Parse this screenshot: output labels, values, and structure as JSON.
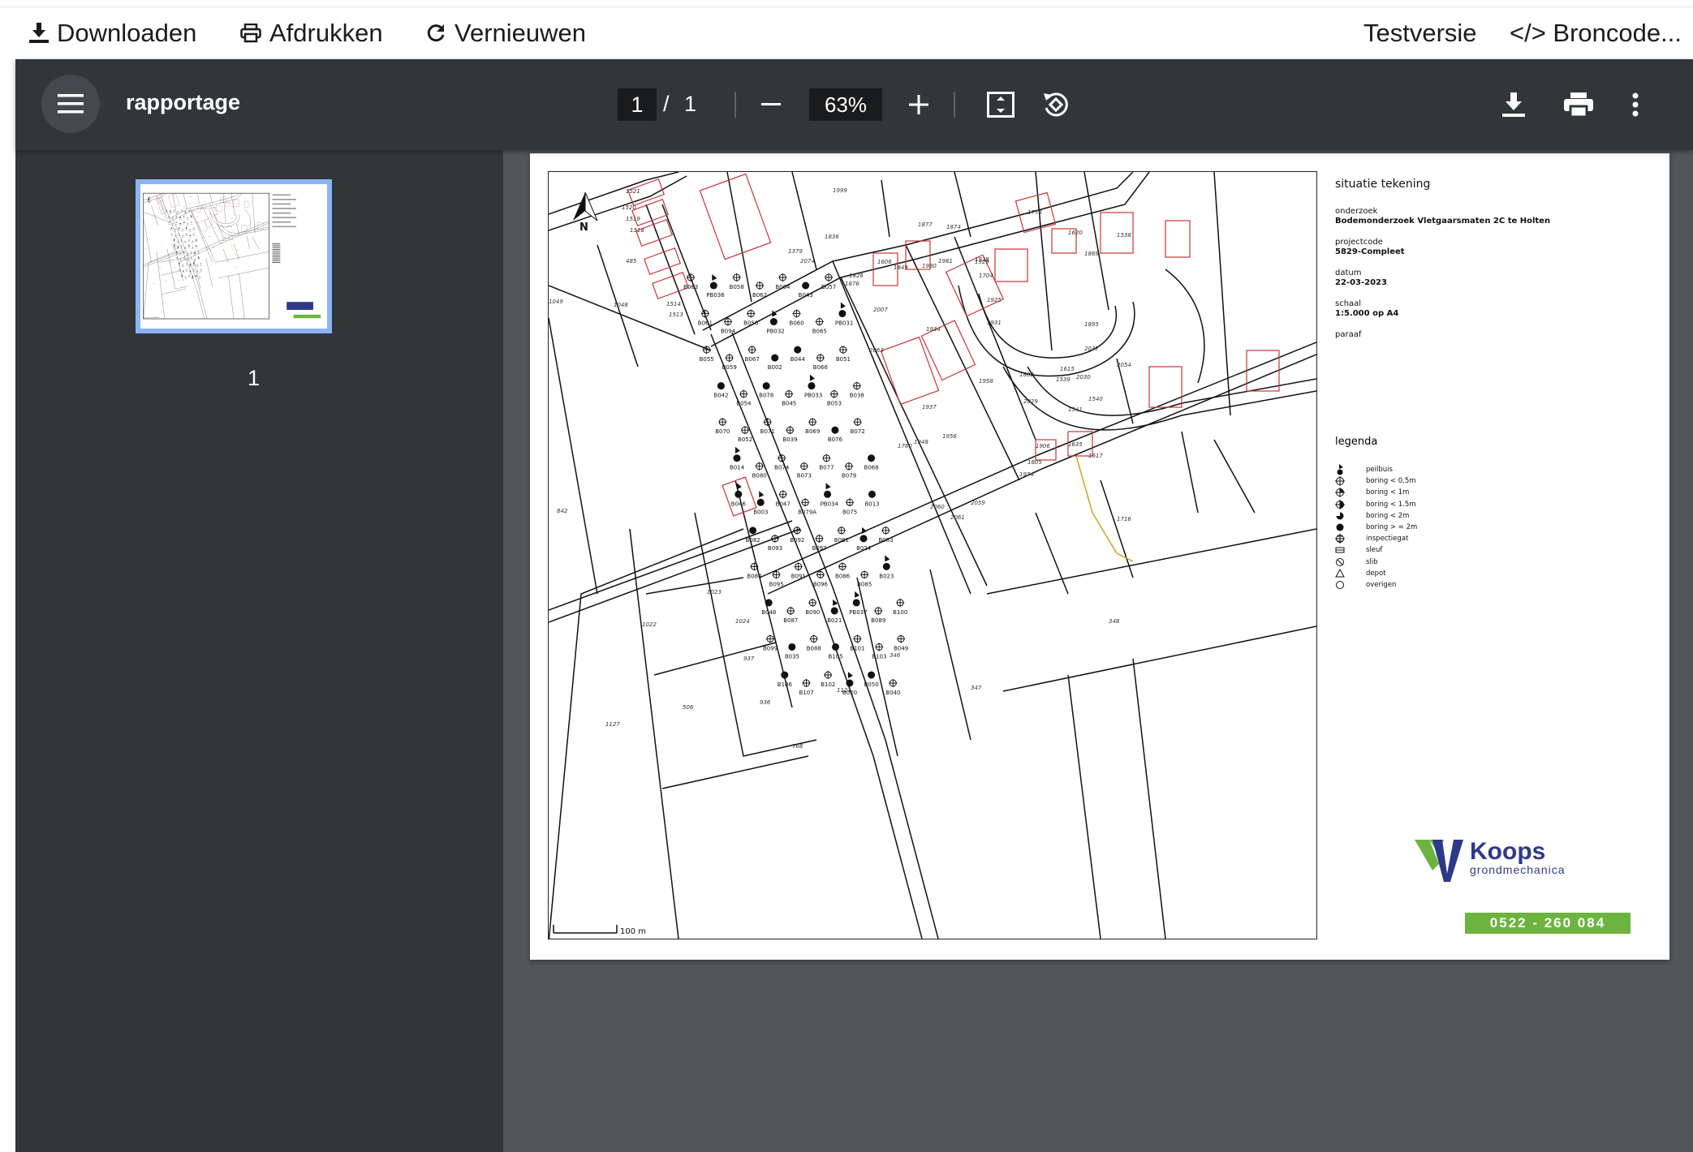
{
  "toolbar": {
    "download": "Downloaden",
    "print": "Afdrukken",
    "refresh": "Vernieuwen",
    "trial": "Testversie",
    "source": "</> Broncode..."
  },
  "viewer": {
    "title": "rapportage",
    "current_page": "1",
    "separator": "/",
    "total_pages": "1",
    "zoom": "63%",
    "thumbnail_label": "1"
  },
  "sheet": {
    "heading": "situatie tekening",
    "fields": [
      {
        "label": "onderzoek",
        "value": "Bodemonderzoek Vletgaarsmaten 2C te Holten"
      },
      {
        "label": "projectcode",
        "value": "5829-Compleet"
      },
      {
        "label": "datum",
        "value": "22-03-2023"
      },
      {
        "label": "schaal",
        "value": "1:5.000 op A4"
      },
      {
        "label": "paraaf",
        "value": ""
      }
    ],
    "north": "N",
    "scale_label": "100 m",
    "legend_title": "legenda",
    "legend": [
      {
        "symbol": "peilbuis-icon",
        "label": "peilbuis"
      },
      {
        "symbol": "boring-05-icon",
        "label": "boring < 0.5m"
      },
      {
        "symbol": "boring-1-icon",
        "label": "boring < 1m"
      },
      {
        "symbol": "boring-15-icon",
        "label": "boring < 1.5m"
      },
      {
        "symbol": "boring-2-icon",
        "label": "boring < 2m"
      },
      {
        "symbol": "boring-2plus-icon",
        "label": "boring > = 2m"
      },
      {
        "symbol": "inspectiegat-icon",
        "label": "inspectiegat"
      },
      {
        "symbol": "sleuf-icon",
        "label": "sleuf"
      },
      {
        "symbol": "slib-icon",
        "label": "slib"
      },
      {
        "symbol": "depot-icon",
        "label": "depot"
      },
      {
        "symbol": "overigen-icon",
        "label": "overigen"
      }
    ],
    "logo_name": "Koops",
    "logo_sub": "grondmechanica",
    "phone": "0522 - 260 084",
    "colors": {
      "logo_blue": "#2e3a87",
      "logo_green": "#6cb33f"
    },
    "parcels": [
      {
        "label": "1999"
      },
      {
        "label": "1877"
      },
      {
        "label": "1874"
      },
      {
        "label": "1778"
      },
      {
        "label": "1620"
      },
      {
        "label": "1538"
      },
      {
        "label": "1869"
      },
      {
        "label": "1379"
      },
      {
        "label": "1876"
      },
      {
        "label": "2074"
      },
      {
        "label": "1836"
      },
      {
        "label": "1826"
      },
      {
        "label": "2007"
      },
      {
        "label": "1606"
      },
      {
        "label": "1849"
      },
      {
        "label": "1980"
      },
      {
        "label": "1981"
      },
      {
        "label": "1929"
      },
      {
        "label": "1928"
      },
      {
        "label": "1704"
      },
      {
        "label": "1925"
      },
      {
        "label": "1931"
      },
      {
        "label": "1934"
      },
      {
        "label": "1895"
      },
      {
        "label": "1958"
      },
      {
        "label": "1882"
      },
      {
        "label": "1615"
      },
      {
        "label": "1539"
      },
      {
        "label": "1540"
      },
      {
        "label": "2030"
      },
      {
        "label": "2037"
      },
      {
        "label": "2054"
      },
      {
        "label": "1906"
      },
      {
        "label": "1635"
      },
      {
        "label": "1617"
      },
      {
        "label": "1974"
      },
      {
        "label": "1805"
      },
      {
        "label": "1716"
      },
      {
        "label": "2059"
      },
      {
        "label": "2060"
      },
      {
        "label": "2061"
      },
      {
        "label": "485"
      },
      {
        "label": "1048"
      },
      {
        "label": "1049"
      },
      {
        "label": "1521"
      },
      {
        "label": "1520"
      },
      {
        "label": "1519"
      },
      {
        "label": "1518"
      },
      {
        "label": "1514"
      },
      {
        "label": "1513"
      },
      {
        "label": "842"
      },
      {
        "label": "1023"
      },
      {
        "label": "1022"
      },
      {
        "label": "1024"
      },
      {
        "label": "937"
      },
      {
        "label": "936"
      },
      {
        "label": "506"
      },
      {
        "label": "1127"
      },
      {
        "label": "768"
      },
      {
        "label": "347"
      },
      {
        "label": "348"
      },
      {
        "label": "346"
      },
      {
        "label": "1121"
      },
      {
        "label": "2063"
      },
      {
        "label": "1760"
      },
      {
        "label": "1937"
      },
      {
        "label": "1948"
      },
      {
        "label": "1956"
      },
      {
        "label": "1541"
      },
      {
        "label": "2029"
      }
    ],
    "boreholes": [
      {
        "id": "B063",
        "t": "b"
      },
      {
        "id": "PB036",
        "t": "p"
      },
      {
        "id": "B058",
        "t": "b"
      },
      {
        "id": "B062",
        "t": "b"
      },
      {
        "id": "B064",
        "t": "b"
      },
      {
        "id": "B043",
        "t": "f"
      },
      {
        "id": "B057",
        "t": "b"
      },
      {
        "id": "B061",
        "t": "b"
      },
      {
        "id": "B094",
        "t": "b"
      },
      {
        "id": "B056",
        "t": "b"
      },
      {
        "id": "PB032",
        "t": "p"
      },
      {
        "id": "B060",
        "t": "b"
      },
      {
        "id": "B065",
        "t": "b"
      },
      {
        "id": "PB031",
        "t": "p"
      },
      {
        "id": "B055",
        "t": "b"
      },
      {
        "id": "B059",
        "t": "b"
      },
      {
        "id": "B067",
        "t": "b"
      },
      {
        "id": "B002",
        "t": "f"
      },
      {
        "id": "B044",
        "t": "f"
      },
      {
        "id": "B066",
        "t": "b"
      },
      {
        "id": "B051",
        "t": "b"
      },
      {
        "id": "B042",
        "t": "f"
      },
      {
        "id": "B054",
        "t": "b"
      },
      {
        "id": "B078",
        "t": "f"
      },
      {
        "id": "B045",
        "t": "b"
      },
      {
        "id": "PB033",
        "t": "p"
      },
      {
        "id": "B053",
        "t": "b"
      },
      {
        "id": "B038",
        "t": "b"
      },
      {
        "id": "B070",
        "t": "b"
      },
      {
        "id": "B052",
        "t": "b"
      },
      {
        "id": "B071",
        "t": "b"
      },
      {
        "id": "B039",
        "t": "b"
      },
      {
        "id": "B069",
        "t": "b"
      },
      {
        "id": "B076",
        "t": "f"
      },
      {
        "id": "B072",
        "t": "b"
      },
      {
        "id": "B014",
        "t": "p"
      },
      {
        "id": "B080",
        "t": "b"
      },
      {
        "id": "B074",
        "t": "b"
      },
      {
        "id": "B073",
        "t": "b"
      },
      {
        "id": "B077",
        "t": "b"
      },
      {
        "id": "B079",
        "t": "b"
      },
      {
        "id": "B068",
        "t": "f"
      },
      {
        "id": "B046",
        "t": "p"
      },
      {
        "id": "B003",
        "t": "p"
      },
      {
        "id": "B047",
        "t": "b"
      },
      {
        "id": "B079A",
        "t": "b"
      },
      {
        "id": "PB034",
        "t": "p"
      },
      {
        "id": "B075",
        "t": "b"
      },
      {
        "id": "B013",
        "t": "f"
      },
      {
        "id": "B082",
        "t": "f"
      },
      {
        "id": "B093",
        "t": "b"
      },
      {
        "id": "B092",
        "t": "b"
      },
      {
        "id": "B097",
        "t": "b"
      },
      {
        "id": "B081",
        "t": "b"
      },
      {
        "id": "B024",
        "t": "p"
      },
      {
        "id": "B083",
        "t": "b"
      },
      {
        "id": "B084",
        "t": "b"
      },
      {
        "id": "B095",
        "t": "b"
      },
      {
        "id": "B091",
        "t": "b"
      },
      {
        "id": "B096",
        "t": "b"
      },
      {
        "id": "B086",
        "t": "b"
      },
      {
        "id": "B085",
        "t": "b"
      },
      {
        "id": "B023",
        "t": "p"
      },
      {
        "id": "B048",
        "t": "f"
      },
      {
        "id": "B087",
        "t": "b"
      },
      {
        "id": "B090",
        "t": "b"
      },
      {
        "id": "B021",
        "t": "p"
      },
      {
        "id": "PB037",
        "t": "p"
      },
      {
        "id": "B089",
        "t": "b"
      },
      {
        "id": "B100",
        "t": "b"
      },
      {
        "id": "B099",
        "t": "b"
      },
      {
        "id": "B035",
        "t": "f"
      },
      {
        "id": "B088",
        "t": "b"
      },
      {
        "id": "B105",
        "t": "f"
      },
      {
        "id": "B101",
        "t": "b"
      },
      {
        "id": "B103",
        "t": "b"
      },
      {
        "id": "B049",
        "t": "b"
      },
      {
        "id": "B106",
        "t": "f"
      },
      {
        "id": "B107",
        "t": "b"
      },
      {
        "id": "B102",
        "t": "b"
      },
      {
        "id": "B020",
        "t": "p"
      },
      {
        "id": "B050",
        "t": "f"
      },
      {
        "id": "B040",
        "t": "b"
      }
    ]
  }
}
